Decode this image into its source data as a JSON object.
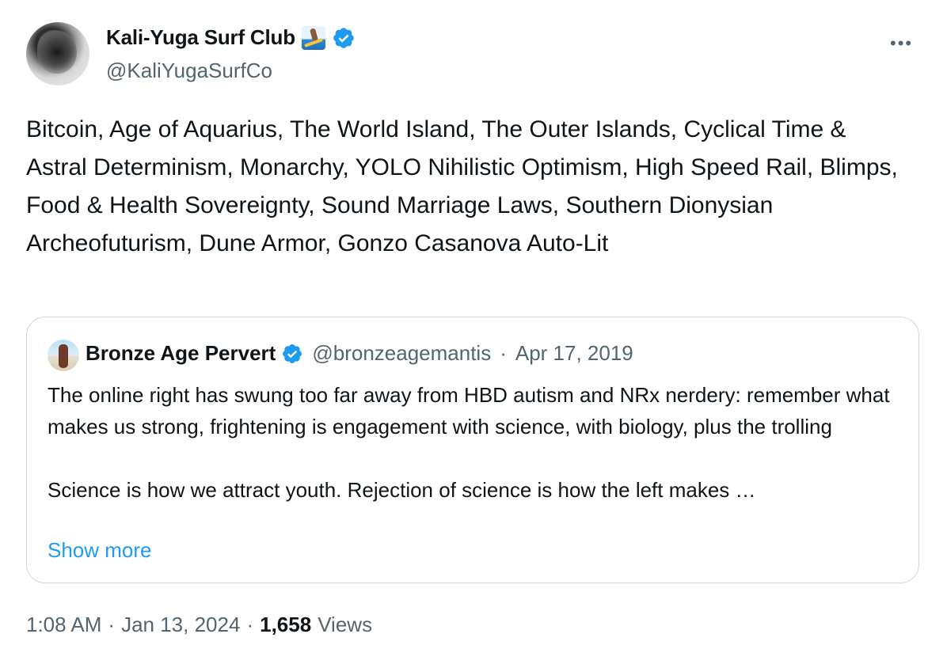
{
  "author": {
    "display_name": "Kali-Yuga Surf Club",
    "handle": "@KaliYugaSurfCo",
    "name_emoji": "surfer-emoji",
    "verified_color": "#1d9bf0"
  },
  "menu": {
    "more_label": "•••"
  },
  "tweet": {
    "text": "Bitcoin, Age of Aquarius, The World Island, The Outer Islands, Cyclical Time & Astral Determinism, Monarchy, YOLO Nihilistic Optimism, High Speed Rail, Blimps, Food & Health Sovereignty, Sound Marriage Laws, Southern Dionysian Archeofuturism, Dune Armor, Gonzo Casanova Auto-Lit"
  },
  "quote": {
    "display_name": "Bronze Age Pervert",
    "handle": "@bronzeagemantis",
    "separator": "·",
    "date": "Apr 17, 2019",
    "text": "The online right has swung too far away from HBD autism and NRx nerdery: remember what makes us strong, frightening is engagement with science, with biology, plus the trolling\n\nScience is how we attract youth. Rejection of science is how the left makes …",
    "show_more": "Show more"
  },
  "footer": {
    "time": "1:08 AM",
    "separator": "·",
    "date": "Jan 13, 2024",
    "views_count": "1,658",
    "views_label": "Views"
  },
  "colors": {
    "text_primary": "#0f1419",
    "text_secondary": "#536471",
    "link": "#1d9bf0",
    "border": "#cfd9de"
  }
}
